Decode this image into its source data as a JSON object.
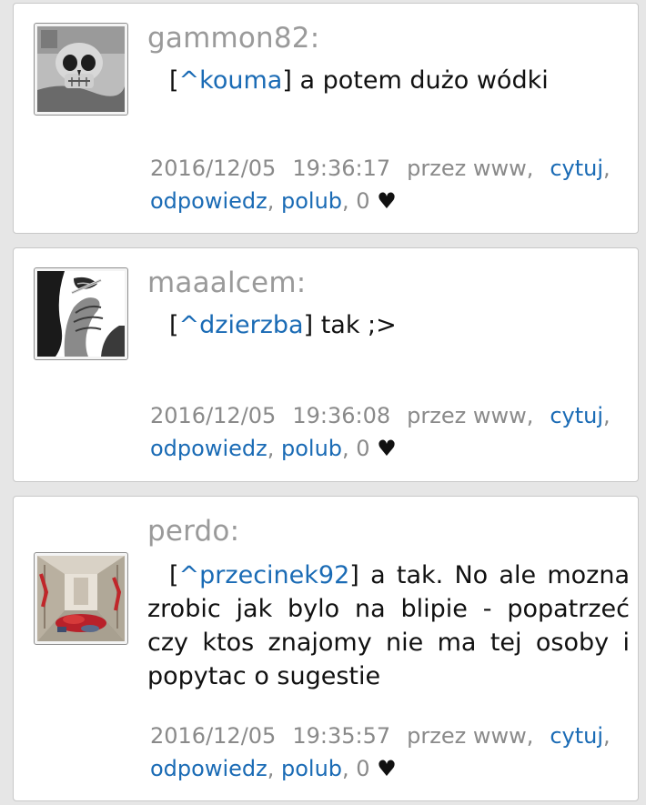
{
  "comments": [
    {
      "author": "gammon82:",
      "reply_prefix": "[",
      "mention": "^kouma",
      "reply_suffix": "]",
      "text": " a potem dużo wódki",
      "date": "2016/12/05",
      "time": "19:36:17",
      "via": "przez www,",
      "quote_label": "cytuj",
      "reply_label": "odpowiedz",
      "like_label": "polub",
      "like_count": "0",
      "heart": "♥",
      "avatar_icon": "skull-avatar-icon"
    },
    {
      "author": "maaalcem:",
      "reply_prefix": "[",
      "mention": "^dzierzba",
      "reply_suffix": "]",
      "text": " tak ;>",
      "date": "2016/12/05",
      "time": "19:36:08",
      "via": "przez www,",
      "quote_label": "cytuj",
      "reply_label": "odpowiedz",
      "like_label": "polub",
      "like_count": "0",
      "heart": "♥",
      "avatar_icon": "smoking-hand-avatar-icon"
    },
    {
      "author": "perdo:",
      "reply_prefix": "[",
      "mention": "^przecinek92",
      "reply_suffix": "]",
      "text": " a tak. No ale mozna zrobic jak bylo na blipie - popatrzeć czy ktos znajomy nie ma tej osoby i popytac o sugestie",
      "date": "2016/12/05",
      "time": "19:35:57",
      "via": "przez www,",
      "quote_label": "cytuj",
      "reply_label": "odpowiedz",
      "like_label": "polub",
      "like_count": "0",
      "heart": "♥",
      "avatar_icon": "corridor-avatar-icon"
    }
  ],
  "colors": {
    "background": "#e6e6e6",
    "card": "#ffffff",
    "author": "#9a9a9a",
    "link": "#1a6bb5",
    "meta": "#8a8a8a"
  }
}
